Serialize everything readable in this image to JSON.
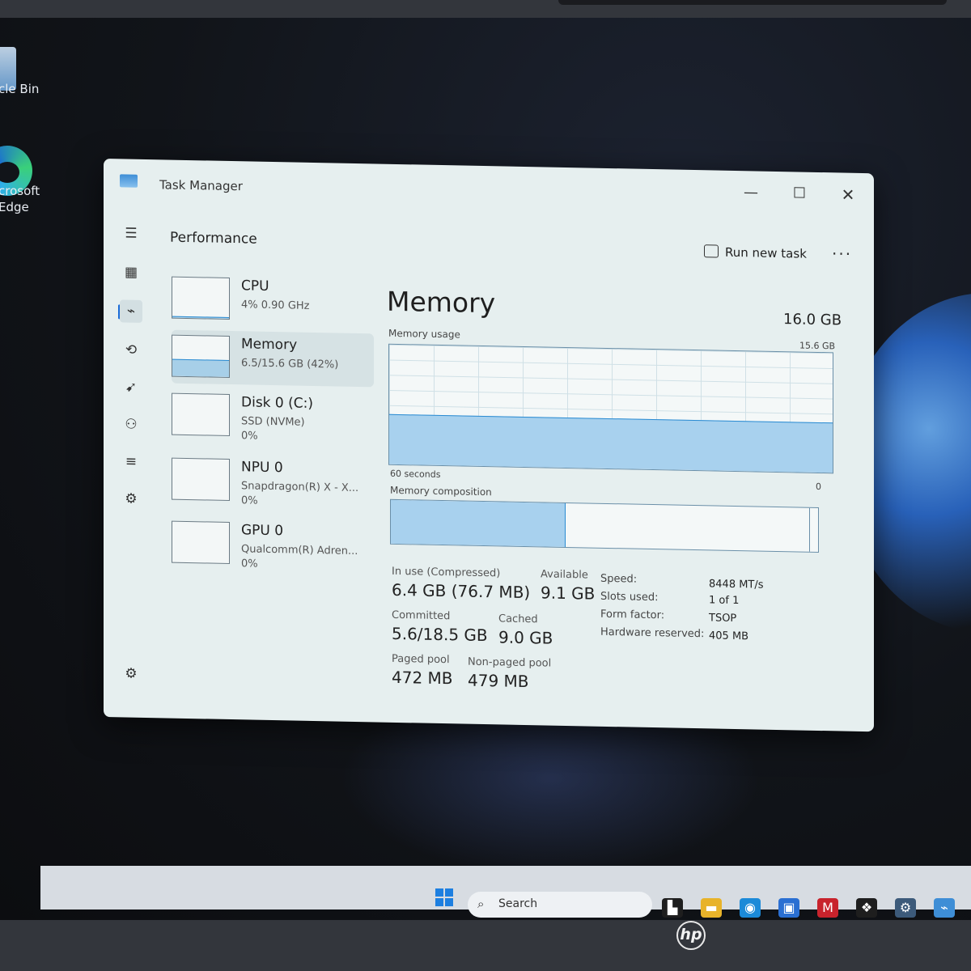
{
  "desktop": {
    "icons": [
      {
        "label_line1": "cle Bin"
      },
      {
        "label_line1": "crosoft",
        "label_line2": "Edge"
      }
    ]
  },
  "window": {
    "title": "Task Manager",
    "minimize_icon": "minimize-icon",
    "maximize_icon": "maximize-icon",
    "close_icon": "close-icon"
  },
  "nav": {
    "items": [
      {
        "icon": "hamburger-icon",
        "glyph": "☰"
      },
      {
        "icon": "processes-icon",
        "glyph": "▦"
      },
      {
        "icon": "performance-icon",
        "glyph": "⌁"
      },
      {
        "icon": "app-history-icon",
        "glyph": "⟲"
      },
      {
        "icon": "startup-apps-icon",
        "glyph": "➹"
      },
      {
        "icon": "users-icon",
        "glyph": "⚇"
      },
      {
        "icon": "details-icon",
        "glyph": "≡"
      },
      {
        "icon": "services-icon",
        "glyph": "⚙"
      }
    ],
    "settings_glyph": "⚙"
  },
  "header": {
    "title": "Performance",
    "run_new_task": "Run new task",
    "more": "···"
  },
  "resources": [
    {
      "name": "CPU",
      "sub": "4% 0.90 GHz",
      "sub2": "",
      "usage": 0.04
    },
    {
      "name": "Memory",
      "sub": "6.5/15.6 GB (42%)",
      "sub2": "",
      "usage": 0.42
    },
    {
      "name": "Disk 0 (C:)",
      "sub": "SSD (NVMe)",
      "sub2": "0%",
      "usage": 0.0
    },
    {
      "name": "NPU 0",
      "sub": "Snapdragon(R) X - X...",
      "sub2": "0%",
      "usage": 0.0
    },
    {
      "name": "GPU 0",
      "sub": "Qualcomm(R) Adren...",
      "sub2": "0%",
      "usage": 0.0
    }
  ],
  "memory": {
    "title": "Memory",
    "total": "16.0 GB",
    "usage_label": "Memory usage",
    "usage_max": "15.6 GB",
    "time_label": "60 seconds",
    "zero_label": "0",
    "usage_fraction": 0.42,
    "composition_label": "Memory composition",
    "composition_inuse_fraction": 0.41,
    "composition_modified_fraction": 0.01,
    "stats": {
      "in_use_label": "In use (Compressed)",
      "in_use_value": "6.4 GB (76.7 MB)",
      "available_label": "Available",
      "available_value": "9.1 GB",
      "committed_label": "Committed",
      "committed_value": "5.6/18.5 GB",
      "cached_label": "Cached",
      "cached_value": "9.0 GB",
      "paged_label": "Paged pool",
      "paged_value": "472 MB",
      "nonpaged_label": "Non-paged pool",
      "nonpaged_value": "479 MB"
    },
    "specs": [
      {
        "key": "Speed:",
        "value": "8448 MT/s"
      },
      {
        "key": "Slots used:",
        "value": "1 of 1"
      },
      {
        "key": "Form factor:",
        "value": "TSOP"
      },
      {
        "key": "Hardware reserved:",
        "value": "405 MB"
      }
    ]
  },
  "taskbar": {
    "search_placeholder": "Search",
    "search_icon": "search-icon",
    "apps": [
      {
        "icon": "task-view-icon",
        "glyph": "▙",
        "color": "#1e1e1e"
      },
      {
        "icon": "file-explorer-icon",
        "glyph": "▬",
        "color": "#e8b32a"
      },
      {
        "icon": "edge-icon",
        "glyph": "◉",
        "color": "#1b8ad8"
      },
      {
        "icon": "store-icon",
        "glyph": "▣",
        "color": "#2a6fd2"
      },
      {
        "icon": "mcafee-icon",
        "glyph": "M",
        "color": "#c8232c"
      },
      {
        "icon": "dropbox-icon",
        "glyph": "❖",
        "color": "#1e1e1e"
      },
      {
        "icon": "settings-icon",
        "glyph": "⚙",
        "color": "#3c5a7a"
      },
      {
        "icon": "task-manager-icon",
        "glyph": "⌁",
        "color": "#3e8ed6"
      }
    ]
  },
  "hardware": {
    "brand": "hp"
  }
}
